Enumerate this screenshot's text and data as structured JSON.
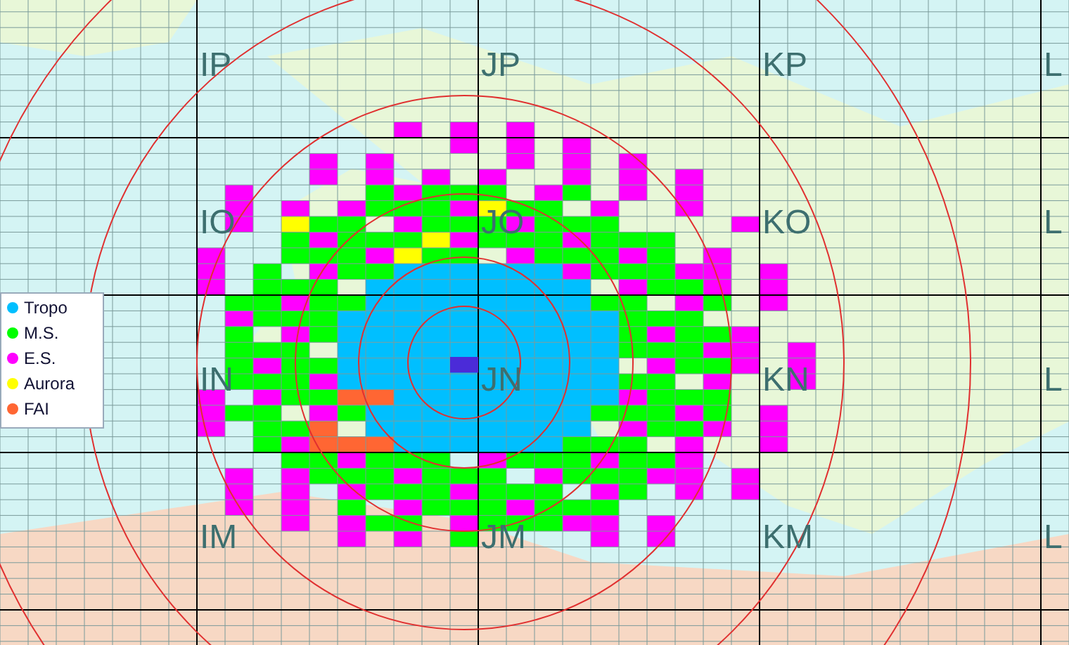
{
  "map": {
    "fields": [
      {
        "label": "IP"
      },
      {
        "label": "JP"
      },
      {
        "label": "KP"
      },
      {
        "label": "L"
      },
      {
        "label": "IO"
      },
      {
        "label": "JO"
      },
      {
        "label": "KO"
      },
      {
        "label": "L"
      },
      {
        "label": "IN"
      },
      {
        "label": "JN"
      },
      {
        "label": "KN"
      },
      {
        "label": "L"
      },
      {
        "label": "IM"
      },
      {
        "label": "JM"
      },
      {
        "label": "KM"
      },
      {
        "label": "L"
      }
    ]
  },
  "legend": [
    {
      "label": "Tropo",
      "color": "#00bfff"
    },
    {
      "label": "M.S.",
      "color": "#00ff00"
    },
    {
      "label": "E.S.",
      "color": "#ff00ff"
    },
    {
      "label": "Aurora",
      "color": "#ffff00"
    },
    {
      "label": "FAI",
      "color": "#ff6633"
    }
  ]
}
